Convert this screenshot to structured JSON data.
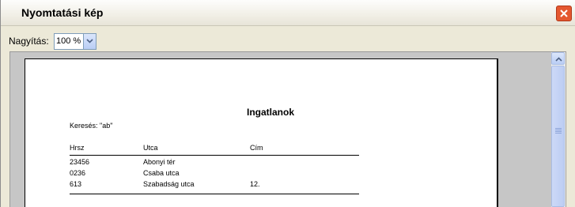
{
  "window": {
    "title": "Nyomtatási kép"
  },
  "zoom": {
    "label": "Nagyítás:",
    "value": "100 %"
  },
  "document": {
    "title": "Ingatlanok",
    "search_text": "Keresés: \"ab\"",
    "columns": [
      "Hrsz",
      "Utca",
      "Cím"
    ],
    "rows": [
      [
        "23456",
        "Abonyi tér",
        ""
      ],
      [
        "0236",
        "Csaba utca",
        ""
      ],
      [
        "613",
        "Szabadság utca",
        "12."
      ]
    ]
  },
  "icons": {
    "close": "close-icon",
    "dropdown": "chevron-down-icon",
    "scroll_up": "chevron-up-icon"
  },
  "colors": {
    "close_button": "#e4572f",
    "preview_background": "#c6c6c6"
  }
}
